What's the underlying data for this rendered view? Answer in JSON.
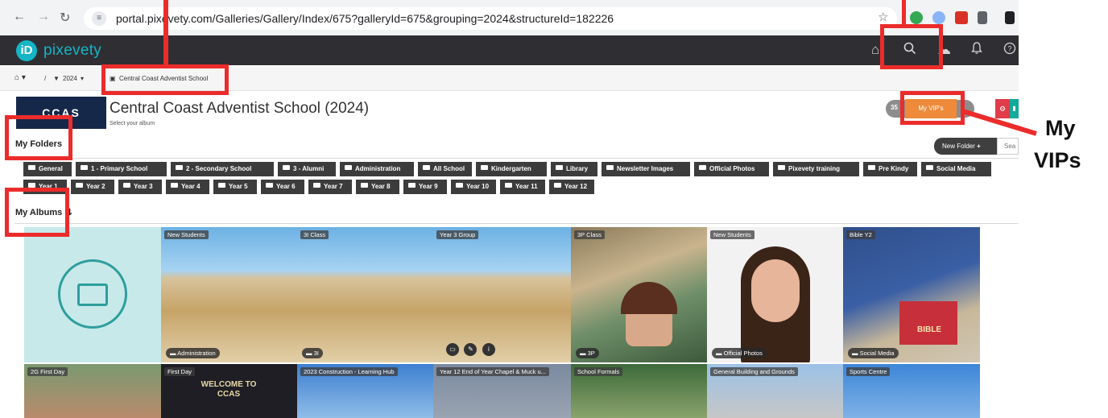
{
  "browser": {
    "url": "portal.pixevety.com/Galleries/Gallery/Index/675?galleryId=675&grouping=2024&structureId=182226"
  },
  "app": {
    "logo_text": "pixevety",
    "logo_mark": "iD"
  },
  "breadcrumb": {
    "year": "2024",
    "current": "Central Coast Adventist School"
  },
  "school": {
    "logo_text": "CCAS",
    "title": "Central Coast Adventist School (2024)",
    "subtitle": "Select your album"
  },
  "actions": {
    "count_label": "35",
    "vip_label": "My VIP's",
    "new_folder_label": "New Folder",
    "search_placeholder": "Sea"
  },
  "sections": {
    "folders_title": "My Folders",
    "albums_title": "My Albums"
  },
  "folders_row1": [
    "General",
    "1 - Primary School",
    "2 - Secondary School",
    "3 - Alumni",
    "Administration",
    "All School",
    "Kindergarten",
    "Library",
    "Newsletter Images",
    "Official Photos",
    "Pixevety training",
    "Pre Kindy",
    "Social Media"
  ],
  "folders_row2": [
    "Year 1",
    "Year 2",
    "Year 3",
    "Year 4",
    "Year 5",
    "Year 6",
    "Year 7",
    "Year 8",
    "Year 9",
    "Year 10",
    "Year 11",
    "Year 12"
  ],
  "albums_row1": [
    {
      "title": "",
      "badge": ""
    },
    {
      "title": "New Students",
      "badge": "Administration"
    },
    {
      "title": "3I Class",
      "badge": "3I"
    },
    {
      "title": "Year 3 Group",
      "badge": ""
    },
    {
      "title": "3P Class",
      "badge": "3P"
    },
    {
      "title": "New Students",
      "badge": "Official Photos"
    },
    {
      "title": "Bible Y2",
      "badge": "Social Media"
    }
  ],
  "albums_row2": [
    {
      "title": "2G First Day"
    },
    {
      "title": "First Day"
    },
    {
      "title": "2023 Construction - Learning Hub"
    },
    {
      "title": "Year 12 End of Year Chapel & Muck u..."
    },
    {
      "title": "School Formals"
    },
    {
      "title": "General Building and Grounds"
    },
    {
      "title": "Sports Centre"
    }
  ],
  "welcome_sign": "WELCOME TO CCAS",
  "bible_sign": "BIBLE",
  "annotation": {
    "label_line1": "My",
    "label_line2": "VIPs"
  },
  "colors": {
    "header_bg": "#2f2f33",
    "brand": "#13b5c6",
    "vip": "#ee8a3a",
    "annotation": "#ec2b2b"
  }
}
